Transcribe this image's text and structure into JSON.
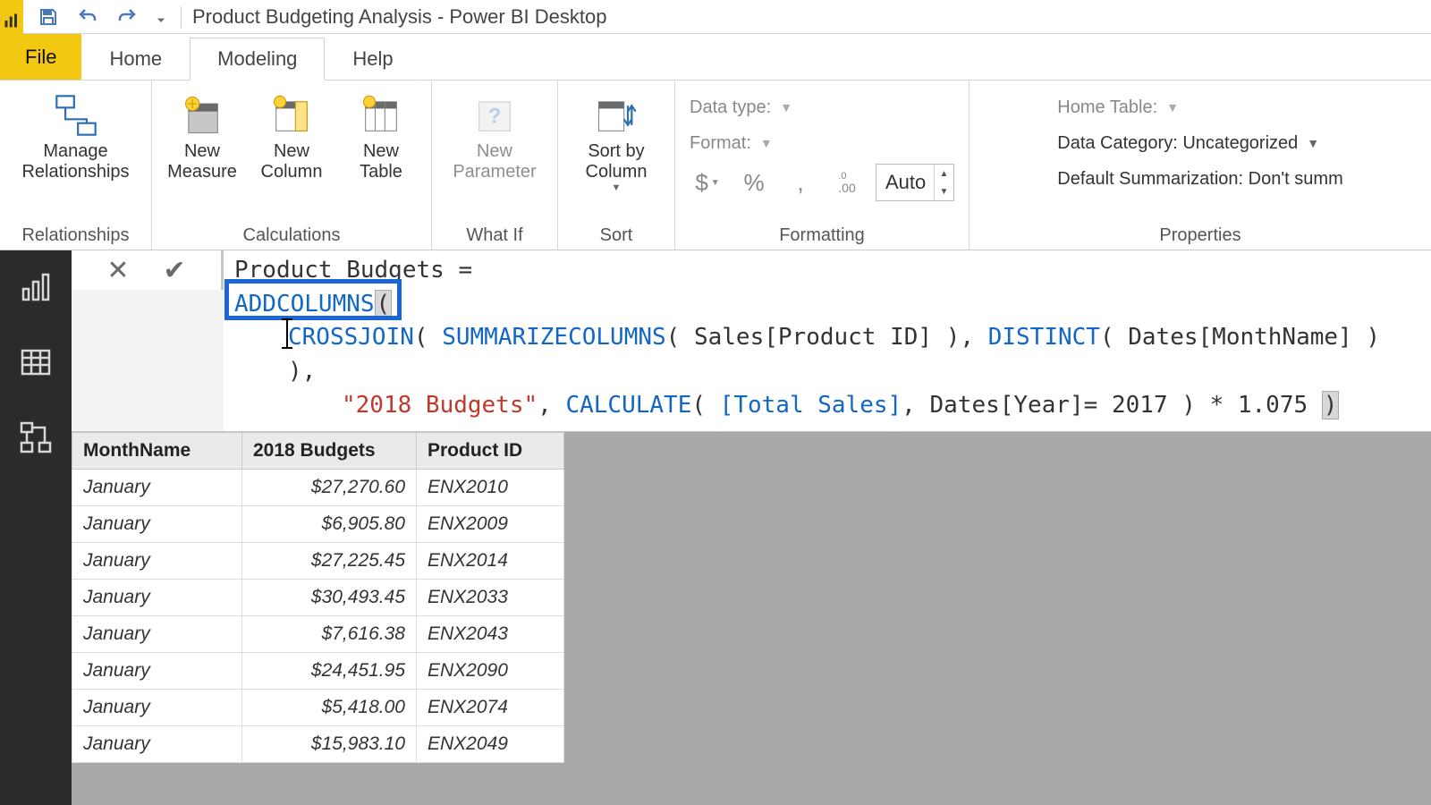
{
  "titlebar": {
    "app_title": "Product Budgeting Analysis - Power BI Desktop"
  },
  "tabs": {
    "file": "File",
    "home": "Home",
    "modeling": "Modeling",
    "help": "Help"
  },
  "ribbon": {
    "relationships": {
      "label": "Relationships",
      "manage": "Manage\nRelationships"
    },
    "calculations": {
      "label": "Calculations",
      "new_measure": "New\nMeasure",
      "new_column": "New\nColumn",
      "new_table": "New\nTable"
    },
    "whatif": {
      "label": "What If",
      "new_parameter": "New\nParameter"
    },
    "sort": {
      "label": "Sort",
      "sort_by_column": "Sort by\nColumn"
    },
    "formatting": {
      "label": "Formatting",
      "data_type": "Data type:",
      "format": "Format:",
      "dollar": "$",
      "percent": "%",
      "comma": ",",
      "decimals_icon": ".00",
      "auto": "Auto"
    },
    "properties": {
      "label": "Properties",
      "home_table": "Home Table:",
      "data_category": "Data Category: Uncategorized",
      "default_summ": "Default Summarization: Don't summ"
    }
  },
  "formula": {
    "line1_name": "Product Budgets",
    "eq": " = ",
    "addcolumns": "ADDCOLUMNS",
    "crossjoin": "CROSSJOIN",
    "summarizecolumns": "SUMMARIZECOLUMNS",
    "sales_product_id": "Sales[Product ID]",
    "distinct": "DISTINCT",
    "dates_monthname": "Dates[MonthName]",
    "budgets_str": "\"2018 Budgets\"",
    "calculate": "CALCULATE",
    "total_sales": "[Total Sales]",
    "dates_year": "Dates[Year]= 2017",
    "mult": " * 1.075 "
  },
  "table": {
    "headers": [
      "MonthName",
      "2018 Budgets",
      "Product ID"
    ],
    "rows": [
      [
        "January",
        "$27,270.60",
        "ENX2010"
      ],
      [
        "January",
        "$6,905.80",
        "ENX2009"
      ],
      [
        "January",
        "$27,225.45",
        "ENX2014"
      ],
      [
        "January",
        "$30,493.45",
        "ENX2033"
      ],
      [
        "January",
        "$7,616.38",
        "ENX2043"
      ],
      [
        "January",
        "$24,451.95",
        "ENX2090"
      ],
      [
        "January",
        "$5,418.00",
        "ENX2074"
      ],
      [
        "January",
        "$15,983.10",
        "ENX2049"
      ]
    ]
  }
}
